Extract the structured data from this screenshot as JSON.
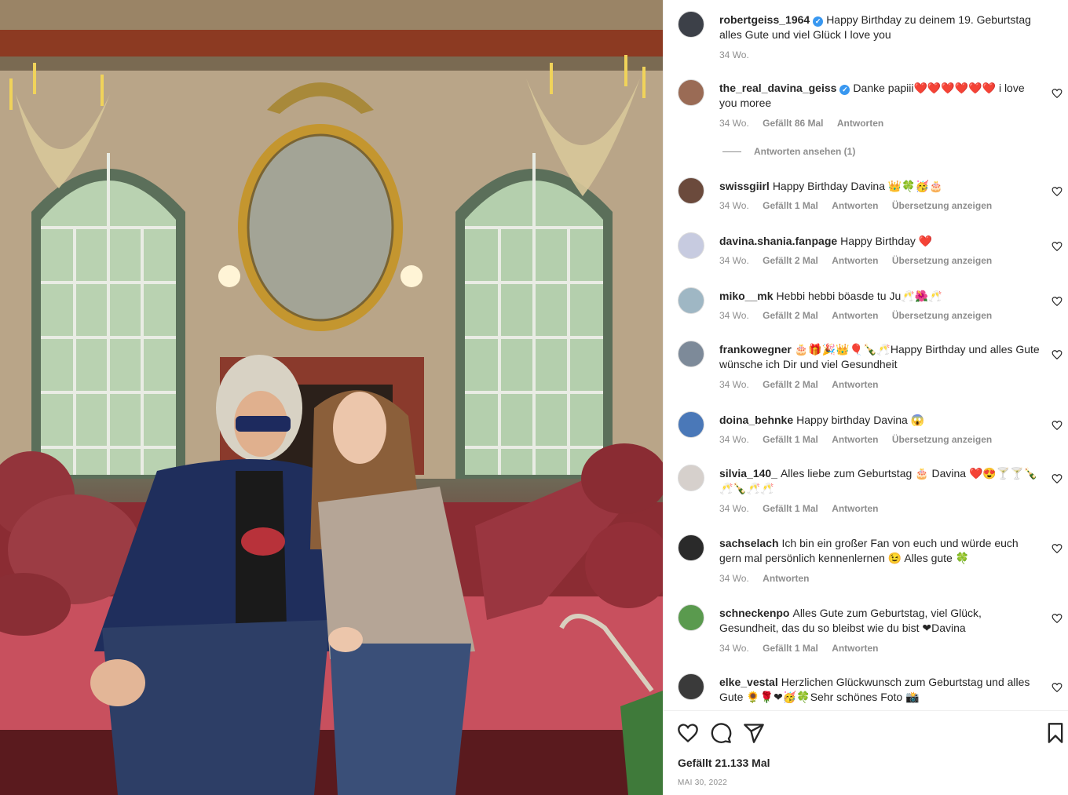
{
  "post": {
    "likes_label": "Gefällt 21.133 Mal",
    "date_label": "MAI 30, 2022"
  },
  "caption": {
    "username": "robertgeiss_1964",
    "text": "Happy Birthday zu deinem 19. Geburtstag alles Gute und viel Glück I love you",
    "time": "34 Wo."
  },
  "reply_toggle": "Antworten ansehen (1)",
  "comments": [
    {
      "username": "the_real_davina_geiss",
      "verified": true,
      "text": "Danke papiii❤️❤️❤️❤️❤️❤️ i love you moree",
      "time": "34 Wo.",
      "likes": "Gefällt 86 Mal",
      "reply": "Antworten",
      "translate": ""
    },
    {
      "username": "swissgiirl",
      "text": "Happy Birthday Davina 👑🍀🥳🎂",
      "time": "34 Wo.",
      "likes": "Gefällt 1 Mal",
      "reply": "Antworten",
      "translate": "Übersetzung anzeigen"
    },
    {
      "username": "davina.shania.fanpage",
      "text": "Happy Birthday ❤️",
      "time": "34 Wo.",
      "likes": "Gefällt 2 Mal",
      "reply": "Antworten",
      "translate": "Übersetzung anzeigen"
    },
    {
      "username": "miko__mk",
      "text": "Hebbi hebbi böasde tu Ju🥂🌺🥂",
      "time": "34 Wo.",
      "likes": "Gefällt 2 Mal",
      "reply": "Antworten",
      "translate": "Übersetzung anzeigen"
    },
    {
      "username": "frankowegner",
      "text": "🎂🎁🎉👑🎈🍾🥂Happy Birthday und alles Gute wünsche ich Dir und viel Gesundheit",
      "time": "34 Wo.",
      "likes": "Gefällt 2 Mal",
      "reply": "Antworten",
      "translate": ""
    },
    {
      "username": "doina_behnke",
      "text": "Happy birthday Davina 😱",
      "time": "34 Wo.",
      "likes": "Gefällt 1 Mal",
      "reply": "Antworten",
      "translate": "Übersetzung anzeigen"
    },
    {
      "username": "silvia_140_",
      "text": "Alles liebe zum Geburtstag 🎂 Davina ❤️😍🍸🍸🍾🥂🍾🥂🥂",
      "time": "34 Wo.",
      "likes": "Gefällt 1 Mal",
      "reply": "Antworten",
      "translate": ""
    },
    {
      "username": "sachselach",
      "text": "Ich bin ein großer Fan von euch und würde euch gern mal persönlich kennenlernen 😉 Alles gute 🍀",
      "time": "34 Wo.",
      "likes": "",
      "reply": "Antworten",
      "translate": ""
    },
    {
      "username": "schneckenpo",
      "text": "Alles Gute zum Geburtstag, viel Glück, Gesundheit, das du so bleibst wie du bist ❤Davina",
      "time": "34 Wo.",
      "likes": "Gefällt 1 Mal",
      "reply": "Antworten",
      "translate": ""
    },
    {
      "username": "elke_vestal",
      "text": "Herzlichen Glückwunsch zum Geburtstag und alles Gute 🌻🌹❤🥳🍀Sehr schönes Foto 📸",
      "time": "",
      "likes": "",
      "reply": "",
      "translate": ""
    }
  ],
  "icons": {
    "like": "heart-icon",
    "comment": "comment-icon",
    "share": "send-icon",
    "save": "bookmark-icon"
  },
  "colors": {
    "verified": "#3897f0",
    "meta": "#8e8e8e",
    "text": "#262626"
  }
}
